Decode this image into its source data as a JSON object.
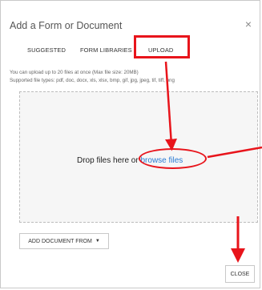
{
  "dialog": {
    "title": "Add a Form or Document",
    "close_icon": "×"
  },
  "tabs": [
    {
      "label": "SUGGESTED"
    },
    {
      "label": "FORM LIBRARIES"
    },
    {
      "label": "UPLOAD"
    }
  ],
  "upload_info": {
    "line1": "You can upload up to 20 files at once (Max file size: 20MB)",
    "line2": "Supported file types: pdf, doc, docx, xls, xlsx, bmp, gif, jpg, jpeg, tif, tiff, png"
  },
  "dropzone": {
    "text": "Drop files here or ",
    "link": "browse files"
  },
  "buttons": {
    "add_document": "ADD DOCUMENT FROM",
    "add_document_caret": "▼",
    "close": "CLOSE"
  },
  "annotation_color": "#e8141b"
}
